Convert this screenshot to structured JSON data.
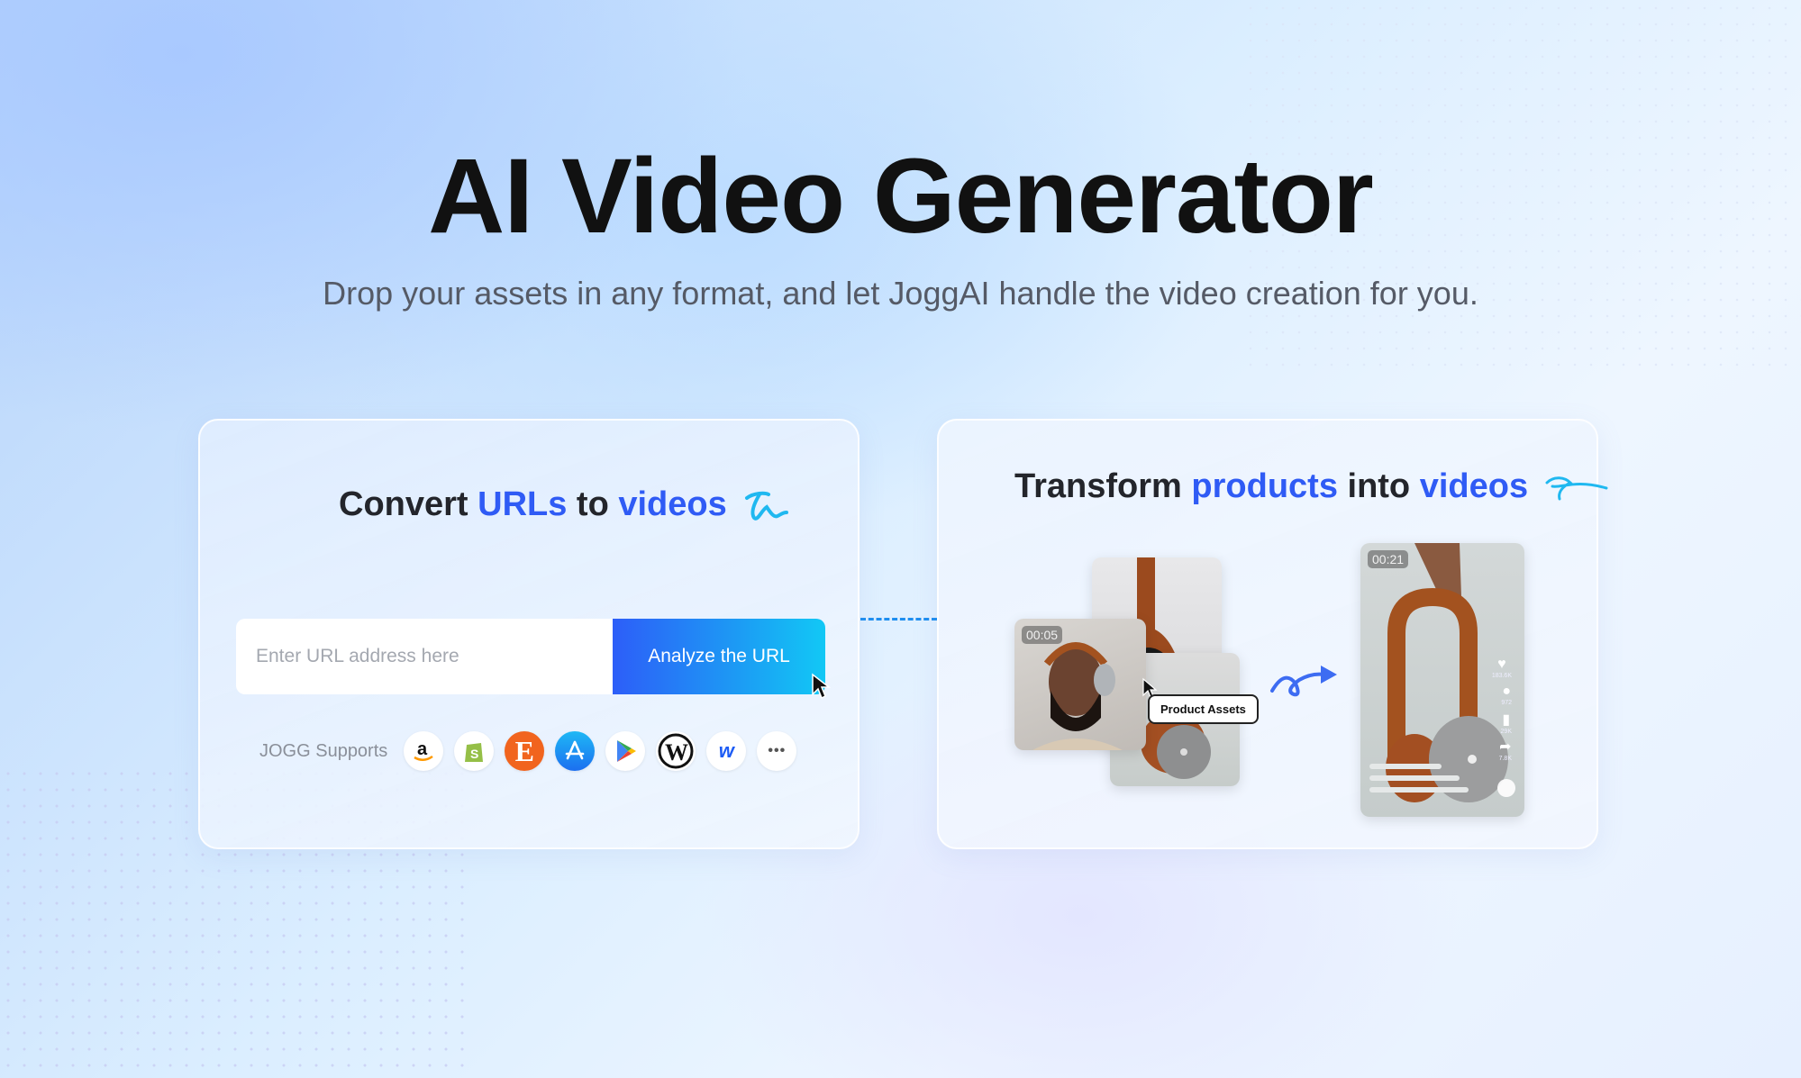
{
  "hero": {
    "title": "AI Video Generator",
    "subtitle": "Drop your assets in any format, and let JoggAI handle the video creation for you."
  },
  "url_card": {
    "title_parts": [
      "Convert ",
      "URLs",
      " to ",
      "videos"
    ],
    "input": {
      "placeholder": "Enter URL address here",
      "value": ""
    },
    "button_label": "Analyze the URL",
    "supports_label": "JOGG Supports",
    "platforms": [
      {
        "name": "Amazon",
        "icon": "amazon-icon",
        "glyph": "a"
      },
      {
        "name": "Shopify",
        "icon": "shopify-icon",
        "glyph": "S"
      },
      {
        "name": "Etsy",
        "icon": "etsy-icon",
        "glyph": "E"
      },
      {
        "name": "App Store",
        "icon": "app-store-icon",
        "glyph": "A"
      },
      {
        "name": "Google Play",
        "icon": "google-play-icon",
        "glyph": "▶"
      },
      {
        "name": "WordPress",
        "icon": "wordpress-icon",
        "glyph": "W"
      },
      {
        "name": "Webflow",
        "icon": "webflow-icon",
        "glyph": "w"
      },
      {
        "name": "More",
        "icon": "more-icon",
        "glyph": "•••"
      }
    ]
  },
  "product_card": {
    "title_parts": [
      "Transform ",
      "products",
      " into ",
      "videos"
    ],
    "asset_timecode": "00:05",
    "tooltip": "Product Assets",
    "video_timecode": "00:21",
    "video_stats": {
      "likes": "183.6K",
      "comments": "972",
      "saves": "29K",
      "shares": "7.8K"
    }
  },
  "colors": {
    "accent": "#2f5bf5",
    "button_start": "#2d5ef8",
    "button_end": "#12c8f5",
    "cyan": "#1fb8f0"
  }
}
